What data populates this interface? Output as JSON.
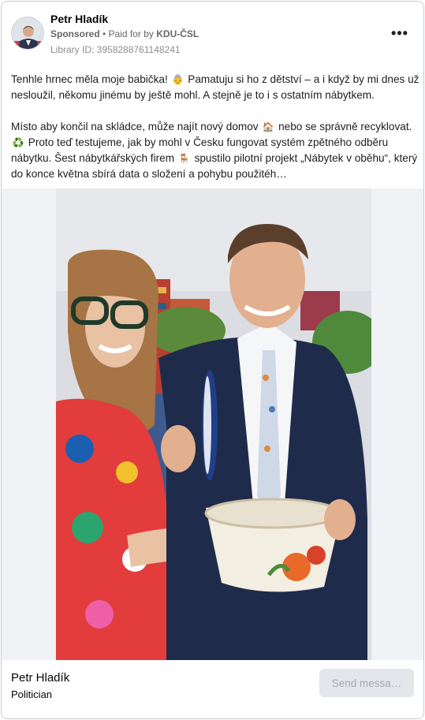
{
  "post": {
    "author": "Petr Hladík",
    "sponsored_label": "Sponsored",
    "paid_for_prefix": " • Paid for by ",
    "payer": "KDU-ČSL",
    "library_id": "Library ID: 3958288761148241",
    "more_icon": "more-options-icon",
    "paragraph1": {
      "part1": "Tenhle hrnec měla moje babička! ",
      "emoji1": "👵",
      "part2": " Pamatuju si ho z dětství – a i když by mi dnes už nesloužil, někomu jinému by ještě mohl. A stejně je to i s ostatním nábytkem."
    },
    "paragraph2": {
      "part1": "Místo aby končil na skládce, může najít nový domov ",
      "emoji1": "🏠",
      "part2": " nebo se správně recyklovat. ",
      "emoji2": "♻️",
      "part3": " Proto teď testujeme, jak by mohl v Česku fungovat systém zpětného odběru nábytku. Šest nábytkářských firem ",
      "emoji3": "🪑",
      "part4": " spustilo pilotní projekt „Nábytek v oběhu“, který do konce května sbírá data o složení a pohybu použitéh…"
    }
  },
  "footer": {
    "name": "Petr Hladík",
    "subtitle": "Politician",
    "send_label": "Send messa…"
  },
  "colors": {
    "border": "#c9ccd1",
    "secondary_text": "#65676b",
    "button_bg": "#e4e6eb"
  }
}
